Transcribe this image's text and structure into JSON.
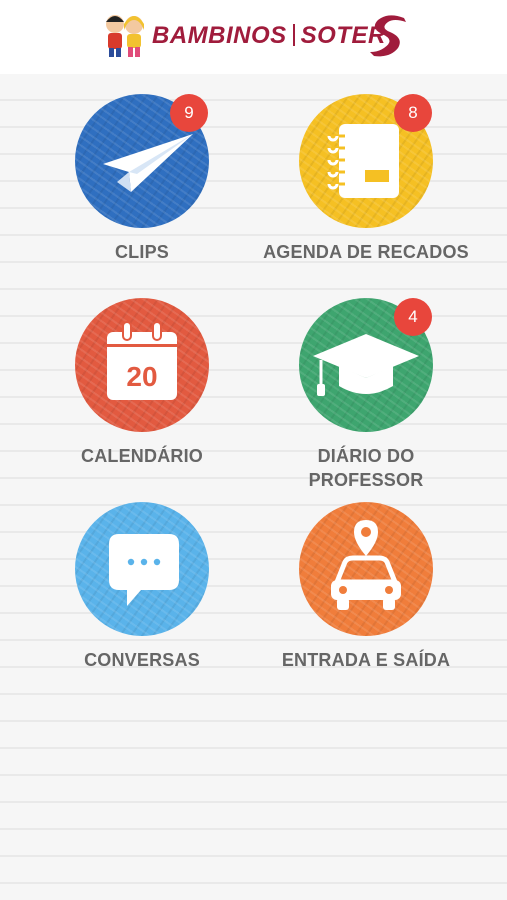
{
  "header": {
    "brand_left": "BAMBINOS",
    "brand_right": "SOTER",
    "logo_icon": "kids-mascot-icon",
    "s_icon": "soter-s-logo-icon",
    "brand_color": "#a01c3c"
  },
  "menu": [
    {
      "label": "CLIPS",
      "badge": "9",
      "color": "#2f6fc0",
      "icon": "paper-plane-icon"
    },
    {
      "label": "AGENDA DE RECADOS",
      "badge": "8",
      "color": "#f5c023",
      "icon": "notebook-icon"
    },
    {
      "label": "CALENDÁRIO",
      "badge": "",
      "color": "#e25a40",
      "icon": "calendar-icon",
      "day": "20"
    },
    {
      "label": "DIÁRIO DO PROFESSOR",
      "label_line1": "DIÁRIO DO",
      "label_line2": "PROFESSOR",
      "badge": "4",
      "color": "#3ea56f",
      "icon": "graduation-cap-icon"
    },
    {
      "label": "CONVERSAS",
      "badge": "",
      "color": "#5ab3ea",
      "icon": "chat-bubble-icon"
    },
    {
      "label": "ENTRADA E SAÍDA",
      "badge": "",
      "color": "#f07d3b",
      "icon": "car-location-icon"
    }
  ],
  "badge_color": "#e8463c"
}
